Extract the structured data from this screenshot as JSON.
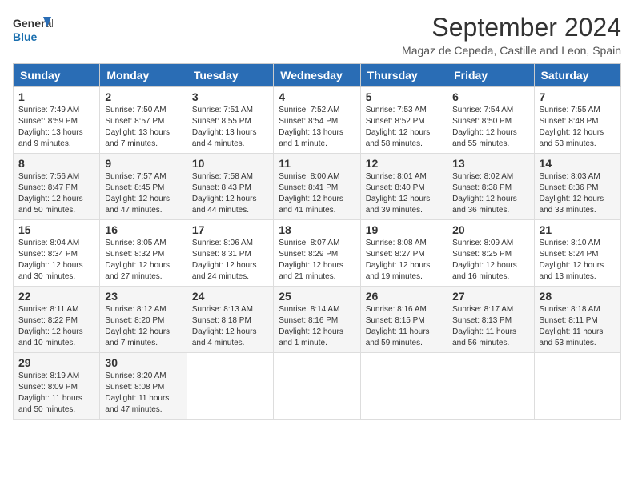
{
  "logo": {
    "line1": "General",
    "line2": "Blue"
  },
  "title": "September 2024",
  "location": "Magaz de Cepeda, Castille and Leon, Spain",
  "days": [
    "Sunday",
    "Monday",
    "Tuesday",
    "Wednesday",
    "Thursday",
    "Friday",
    "Saturday"
  ],
  "weeks": [
    [
      {
        "day": "1",
        "info": "Sunrise: 7:49 AM\nSunset: 8:59 PM\nDaylight: 13 hours and 9 minutes."
      },
      {
        "day": "2",
        "info": "Sunrise: 7:50 AM\nSunset: 8:57 PM\nDaylight: 13 hours and 7 minutes."
      },
      {
        "day": "3",
        "info": "Sunrise: 7:51 AM\nSunset: 8:55 PM\nDaylight: 13 hours and 4 minutes."
      },
      {
        "day": "4",
        "info": "Sunrise: 7:52 AM\nSunset: 8:54 PM\nDaylight: 13 hours and 1 minute."
      },
      {
        "day": "5",
        "info": "Sunrise: 7:53 AM\nSunset: 8:52 PM\nDaylight: 12 hours and 58 minutes."
      },
      {
        "day": "6",
        "info": "Sunrise: 7:54 AM\nSunset: 8:50 PM\nDaylight: 12 hours and 55 minutes."
      },
      {
        "day": "7",
        "info": "Sunrise: 7:55 AM\nSunset: 8:48 PM\nDaylight: 12 hours and 53 minutes."
      }
    ],
    [
      {
        "day": "8",
        "info": "Sunrise: 7:56 AM\nSunset: 8:47 PM\nDaylight: 12 hours and 50 minutes."
      },
      {
        "day": "9",
        "info": "Sunrise: 7:57 AM\nSunset: 8:45 PM\nDaylight: 12 hours and 47 minutes."
      },
      {
        "day": "10",
        "info": "Sunrise: 7:58 AM\nSunset: 8:43 PM\nDaylight: 12 hours and 44 minutes."
      },
      {
        "day": "11",
        "info": "Sunrise: 8:00 AM\nSunset: 8:41 PM\nDaylight: 12 hours and 41 minutes."
      },
      {
        "day": "12",
        "info": "Sunrise: 8:01 AM\nSunset: 8:40 PM\nDaylight: 12 hours and 39 minutes."
      },
      {
        "day": "13",
        "info": "Sunrise: 8:02 AM\nSunset: 8:38 PM\nDaylight: 12 hours and 36 minutes."
      },
      {
        "day": "14",
        "info": "Sunrise: 8:03 AM\nSunset: 8:36 PM\nDaylight: 12 hours and 33 minutes."
      }
    ],
    [
      {
        "day": "15",
        "info": "Sunrise: 8:04 AM\nSunset: 8:34 PM\nDaylight: 12 hours and 30 minutes."
      },
      {
        "day": "16",
        "info": "Sunrise: 8:05 AM\nSunset: 8:32 PM\nDaylight: 12 hours and 27 minutes."
      },
      {
        "day": "17",
        "info": "Sunrise: 8:06 AM\nSunset: 8:31 PM\nDaylight: 12 hours and 24 minutes."
      },
      {
        "day": "18",
        "info": "Sunrise: 8:07 AM\nSunset: 8:29 PM\nDaylight: 12 hours and 21 minutes."
      },
      {
        "day": "19",
        "info": "Sunrise: 8:08 AM\nSunset: 8:27 PM\nDaylight: 12 hours and 19 minutes."
      },
      {
        "day": "20",
        "info": "Sunrise: 8:09 AM\nSunset: 8:25 PM\nDaylight: 12 hours and 16 minutes."
      },
      {
        "day": "21",
        "info": "Sunrise: 8:10 AM\nSunset: 8:24 PM\nDaylight: 12 hours and 13 minutes."
      }
    ],
    [
      {
        "day": "22",
        "info": "Sunrise: 8:11 AM\nSunset: 8:22 PM\nDaylight: 12 hours and 10 minutes."
      },
      {
        "day": "23",
        "info": "Sunrise: 8:12 AM\nSunset: 8:20 PM\nDaylight: 12 hours and 7 minutes."
      },
      {
        "day": "24",
        "info": "Sunrise: 8:13 AM\nSunset: 8:18 PM\nDaylight: 12 hours and 4 minutes."
      },
      {
        "day": "25",
        "info": "Sunrise: 8:14 AM\nSunset: 8:16 PM\nDaylight: 12 hours and 1 minute."
      },
      {
        "day": "26",
        "info": "Sunrise: 8:16 AM\nSunset: 8:15 PM\nDaylight: 11 hours and 59 minutes."
      },
      {
        "day": "27",
        "info": "Sunrise: 8:17 AM\nSunset: 8:13 PM\nDaylight: 11 hours and 56 minutes."
      },
      {
        "day": "28",
        "info": "Sunrise: 8:18 AM\nSunset: 8:11 PM\nDaylight: 11 hours and 53 minutes."
      }
    ],
    [
      {
        "day": "29",
        "info": "Sunrise: 8:19 AM\nSunset: 8:09 PM\nDaylight: 11 hours and 50 minutes."
      },
      {
        "day": "30",
        "info": "Sunrise: 8:20 AM\nSunset: 8:08 PM\nDaylight: 11 hours and 47 minutes."
      },
      {
        "day": "",
        "info": ""
      },
      {
        "day": "",
        "info": ""
      },
      {
        "day": "",
        "info": ""
      },
      {
        "day": "",
        "info": ""
      },
      {
        "day": "",
        "info": ""
      }
    ]
  ]
}
